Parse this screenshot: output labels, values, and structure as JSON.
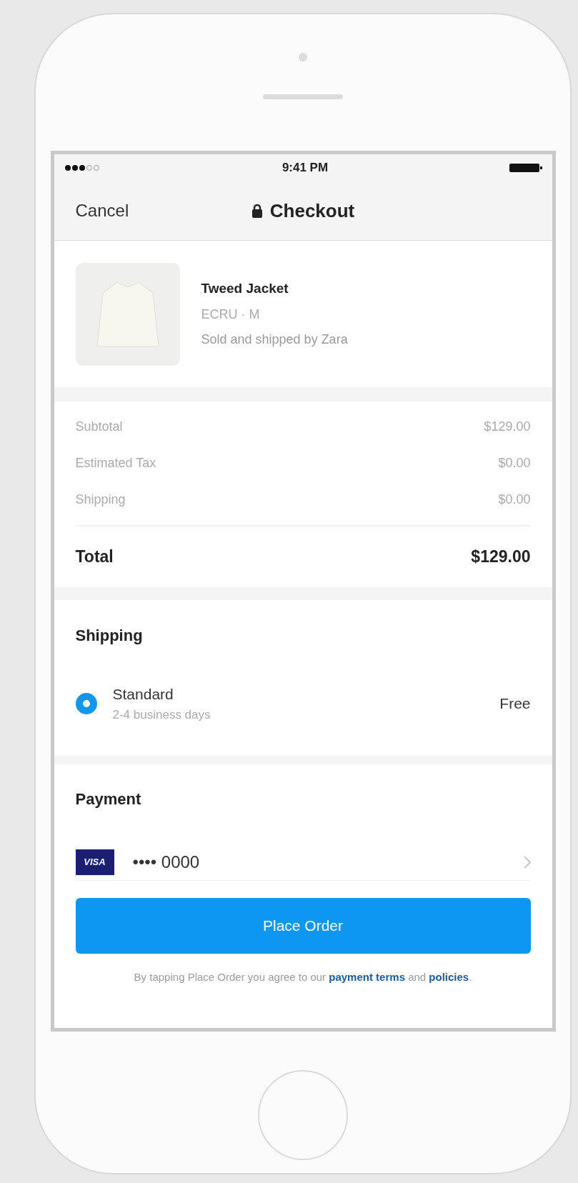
{
  "status_bar": {
    "time": "9:41 PM"
  },
  "nav_bar": {
    "cancel": "Cancel",
    "title": "Checkout"
  },
  "product": {
    "name": "Tweed Jacket",
    "variant": "ECRU · M",
    "seller": "Sold and shipped by Zara"
  },
  "summary": {
    "lines": [
      {
        "label": "Subtotal",
        "value": "$129.00"
      },
      {
        "label": "Estimated Tax",
        "value": "$0.00"
      },
      {
        "label": "Shipping",
        "value": "$0.00"
      }
    ],
    "total": {
      "label": "Total",
      "value": "$129.00"
    }
  },
  "shipping": {
    "heading": "Shipping",
    "options": [
      {
        "name": "Standard",
        "detail": "2-4 business days",
        "price": "Free",
        "selected": true
      }
    ]
  },
  "payment": {
    "heading": "Payment",
    "card": {
      "brand": "VISA",
      "number": "•••• 0000"
    }
  },
  "place_order_button": "Place Order",
  "terms": [
    {
      "kind": "plain",
      "text": "By tapping Place Order you agree to our "
    },
    {
      "kind": "link",
      "text": "payment terms"
    },
    {
      "kind": "plain",
      "text": " and "
    },
    {
      "kind": "link",
      "text": "policies"
    },
    {
      "kind": "plain",
      "text": "."
    }
  ]
}
